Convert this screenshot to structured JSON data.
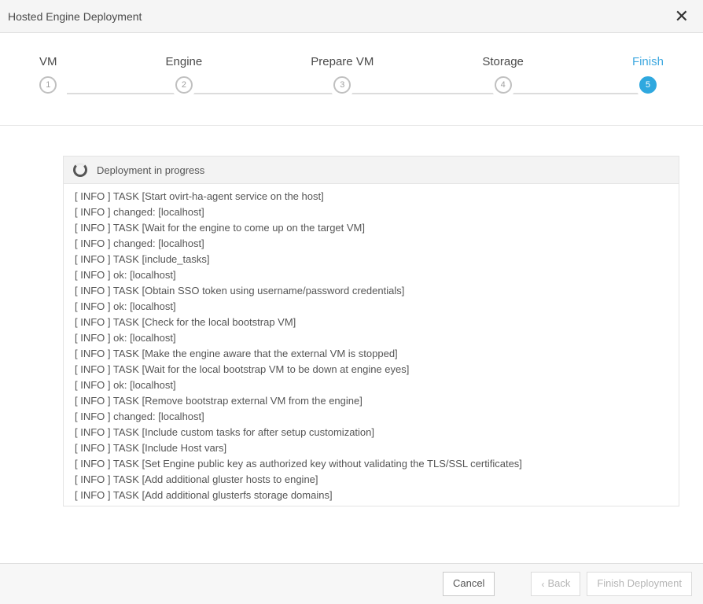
{
  "header": {
    "title": "Hosted Engine Deployment"
  },
  "wizard": {
    "steps": [
      {
        "label": "VM",
        "num": "1"
      },
      {
        "label": "Engine",
        "num": "2"
      },
      {
        "label": "Prepare VM",
        "num": "3"
      },
      {
        "label": "Storage",
        "num": "4"
      },
      {
        "label": "Finish",
        "num": "5"
      }
    ]
  },
  "status": {
    "text": "Deployment in progress"
  },
  "log": [
    "[ INFO  ] TASK [Start ovirt-ha-agent service on the host]",
    "[ INFO  ] changed: [localhost]",
    "[ INFO  ] TASK [Wait for the engine to come up on the target VM]",
    "[ INFO  ] changed: [localhost]",
    "[ INFO  ] TASK [include_tasks]",
    "[ INFO  ] ok: [localhost]",
    "[ INFO  ] TASK [Obtain SSO token using username/password credentials]",
    "[ INFO  ] ok: [localhost]",
    "[ INFO  ] TASK [Check for the local bootstrap VM]",
    "[ INFO  ] ok: [localhost]",
    "[ INFO  ] TASK [Make the engine aware that the external VM is stopped]",
    "[ INFO  ] TASK [Wait for the local bootstrap VM to be down at engine eyes]",
    "[ INFO  ] ok: [localhost]",
    "[ INFO  ] TASK [Remove bootstrap external VM from the engine]",
    "[ INFO  ] changed: [localhost]",
    "[ INFO  ] TASK [Include custom tasks for after setup customization]",
    "[ INFO  ] TASK [Include Host vars]",
    "[ INFO  ] TASK [Set Engine public key as authorized key without validating the TLS/SSL certificates]",
    "[ INFO  ] TASK [Add additional gluster hosts to engine]",
    "[ INFO  ] TASK [Add additional glusterfs storage domains]"
  ],
  "footer": {
    "cancel": "Cancel",
    "back": "Back",
    "finish": "Finish Deployment"
  }
}
